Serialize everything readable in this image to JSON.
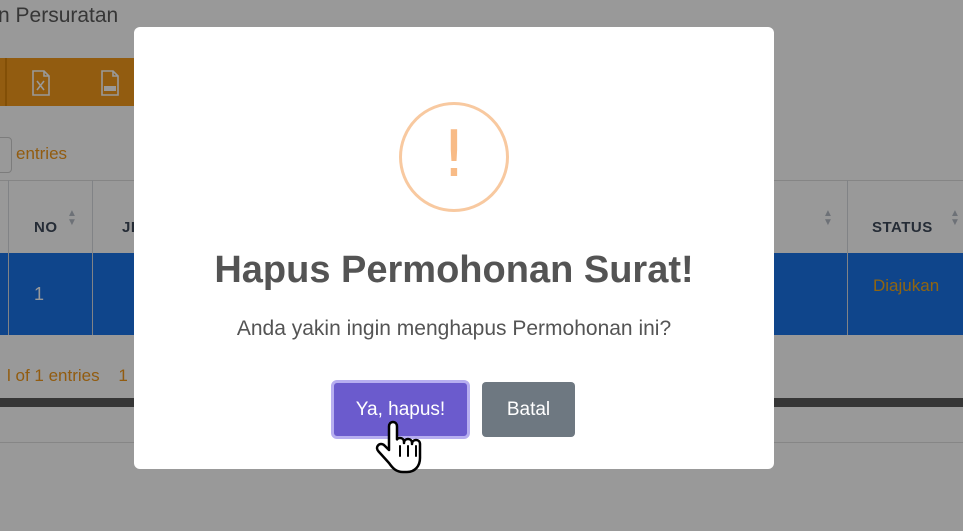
{
  "page": {
    "title": "n Persuratan",
    "entries_label": "entries",
    "info_text": "l of 1 entries",
    "pagination_current": "1",
    "toolbar": {
      "excel_icon": "file-excel-icon",
      "csv_icon": "file-csv-icon"
    }
  },
  "table": {
    "headers": {
      "no": "NO",
      "jenis": "JE",
      "status": "STATUS"
    },
    "rows": [
      {
        "no": "1",
        "jenis": "",
        "status": "Diajukan"
      }
    ]
  },
  "modal": {
    "icon": "warning-icon",
    "icon_symbol": "!",
    "title": "Hapus Permohonan Surat!",
    "text": "Anda yakin ingin menghapus Permohonan ini?",
    "confirm_label": "Ya, hapus!",
    "cancel_label": "Batal"
  },
  "colors": {
    "accent_orange": "#f39a1c",
    "row_highlight": "#1a73e8",
    "confirm_button": "#6b5bcd",
    "cancel_button": "#6e7881",
    "warning": "#f8bb86"
  }
}
